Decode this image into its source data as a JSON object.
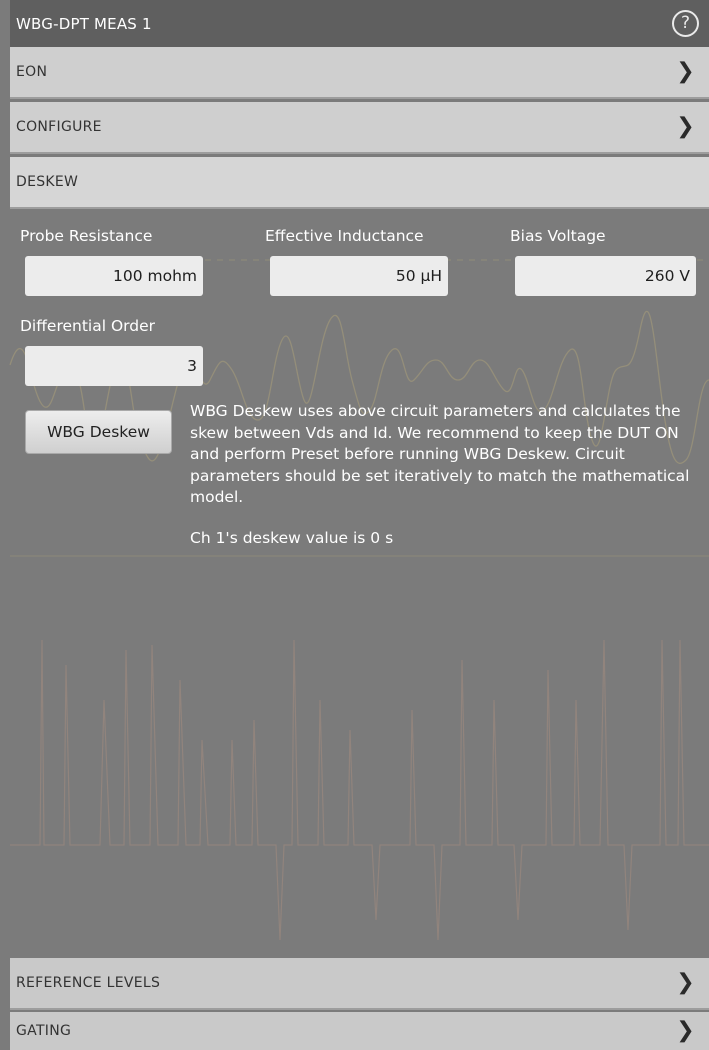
{
  "header": {
    "title": "WBG-DPT MEAS 1",
    "help_icon": "question-circle-icon"
  },
  "sections": {
    "eon": {
      "label": "EON",
      "icon": "chevron-right-icon"
    },
    "configure": {
      "label": "CONFIGURE",
      "icon": "chevron-right-icon"
    },
    "deskew": {
      "label": "DESKEW"
    },
    "reference_levels": {
      "label": "REFERENCE LEVELS",
      "icon": "chevron-right-icon"
    },
    "gating": {
      "label": "GATING",
      "icon": "chevron-right-icon"
    }
  },
  "deskew": {
    "probe_resistance": {
      "label": "Probe Resistance",
      "value": "100 mohm"
    },
    "effective_inductance": {
      "label": "Effective Inductance",
      "value": "50 µH"
    },
    "bias_voltage": {
      "label": "Bias Voltage",
      "value": "260 V"
    },
    "differential_order": {
      "label": "Differential Order",
      "value": "3"
    },
    "button_label": "WBG Deskew",
    "description": "WBG Deskew uses above circuit parameters and calculates the skew between Vds and Id. We recommend to keep the DUT ON and perform Preset before running WBG Deskew. Circuit parameters should be set iteratively to match the mathematical model.",
    "status": "Ch 1's deskew value is 0 s"
  },
  "colors": {
    "panel_bg": "#7b7b7b",
    "title_bar": "#5f5f5f",
    "section_bar": "#cfcfcf",
    "field_bg": "#ececec",
    "trace_1": "#a99f7a",
    "trace_2": "#a88e80"
  }
}
